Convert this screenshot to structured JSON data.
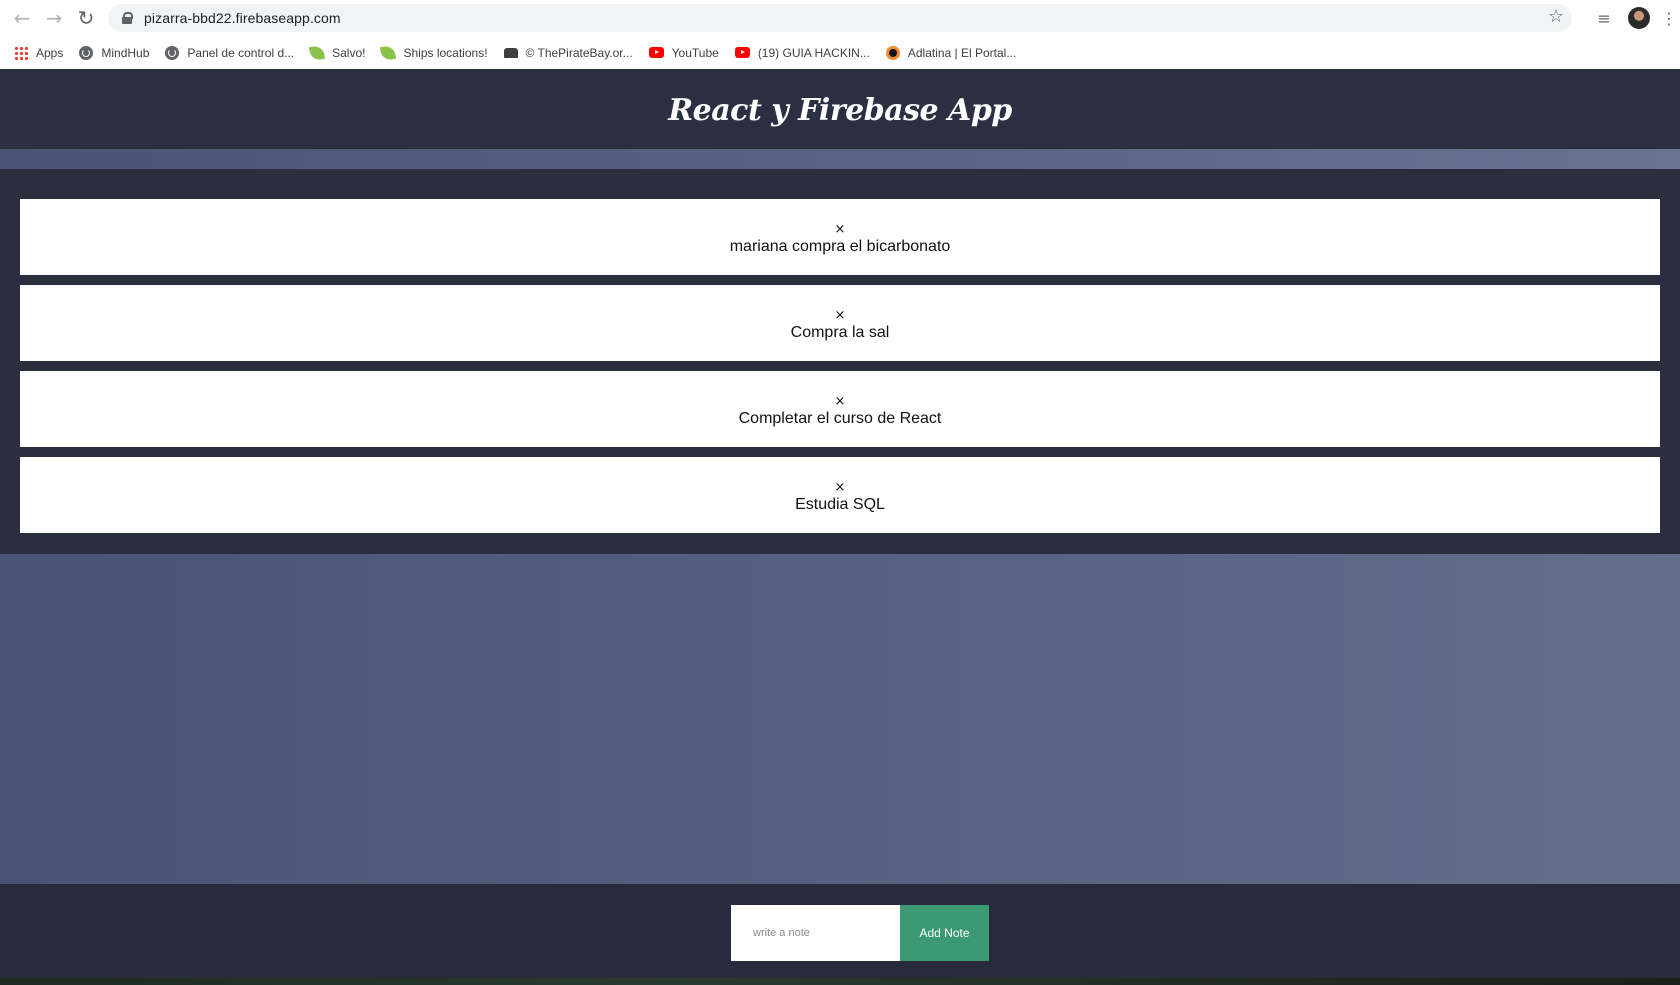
{
  "browser": {
    "url": "pizarra-bbd22.firebaseapp.com",
    "bookmarks": [
      {
        "label": "Apps",
        "icon": "apps-grid-icon"
      },
      {
        "label": "MindHub",
        "icon": "globe-icon"
      },
      {
        "label": "Panel de control d...",
        "icon": "globe-icon"
      },
      {
        "label": "Salvo!",
        "icon": "leaf-icon"
      },
      {
        "label": "Ships locations!",
        "icon": "leaf-icon"
      },
      {
        "label": "© ThePirateBay.or...",
        "icon": "couch-icon"
      },
      {
        "label": "YouTube",
        "icon": "youtube-icon"
      },
      {
        "label": "(19) GUIA HACKIN...",
        "icon": "youtube-icon"
      },
      {
        "label": "Adlatina | El Portal...",
        "icon": "ring-icon"
      }
    ]
  },
  "app": {
    "title": "React y Firebase App"
  },
  "notes": [
    {
      "close": "×",
      "text": "mariana compra el bicarbonato"
    },
    {
      "close": "×",
      "text": "Compra la sal"
    },
    {
      "close": "×",
      "text": "Completar el curso de React"
    },
    {
      "close": "×",
      "text": "Estudia SQL"
    }
  ],
  "form": {
    "placeholder": "write a note",
    "value": "",
    "button_label": "Add Note"
  },
  "colors": {
    "header_bg": "#2b2f41",
    "panel_bg": "#2a2e3f",
    "accent_button": "#3b9a73"
  }
}
